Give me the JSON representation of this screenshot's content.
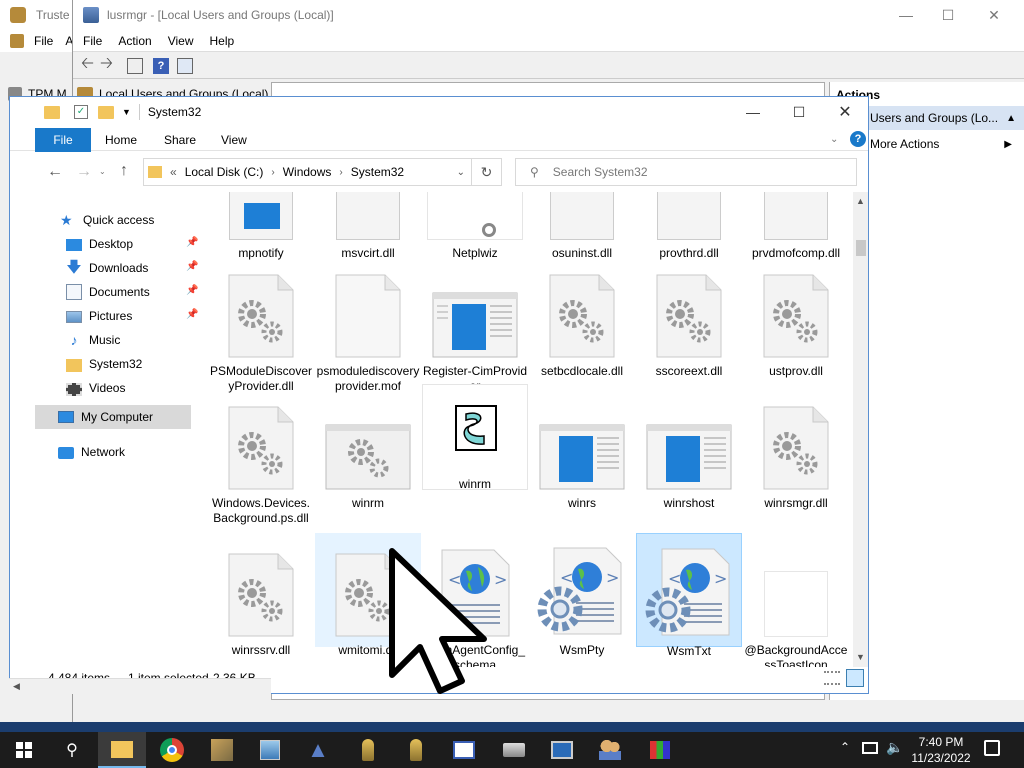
{
  "background_window": {
    "title": "Truste",
    "menu": {
      "file": "File",
      "a": "A"
    },
    "tree_item": "TPM M"
  },
  "lusrmgr": {
    "title": "lusrmgr - [Local Users and Groups (Local)]",
    "menu": [
      "File",
      "Action",
      "View",
      "Help"
    ],
    "tree_item": "Local Users and Groups (Local)",
    "actions_header": "Actions",
    "actions_item": "Users and Groups (Lo...",
    "more_actions": "More Actions"
  },
  "explorer": {
    "title": "System32",
    "ribbon_tabs": [
      "File",
      "Home",
      "Share",
      "View"
    ],
    "address": {
      "prefix": "«",
      "parts": [
        "Local Disk (C:)",
        "Windows",
        "System32"
      ]
    },
    "search_placeholder": "Search System32",
    "nav": {
      "quick_access": "Quick access",
      "items": [
        "Desktop",
        "Downloads",
        "Documents",
        "Pictures",
        "Music",
        "System32",
        "Videos"
      ],
      "my_computer": "My Computer",
      "network": "Network"
    },
    "files_row0": [
      "mpnotify",
      "msvcirt.dll",
      "Netplwiz",
      "osuninst.dll",
      "provthrd.dll",
      "prvdmofcomp.dll"
    ],
    "files_row1": [
      "PSModuleDiscoveryProvider.dll",
      "psmodulediscoveryprovider.mof",
      "Register-CimProvider",
      "setbcdlocale.dll",
      "sscoreext.dll",
      "ustprov.dll"
    ],
    "files_row2": [
      "Windows.Devices.Background.ps.dll",
      "winrm",
      "winrm",
      "winrs",
      "winrshost",
      "winrsmgr.dll"
    ],
    "files_row3": [
      "winrssrv.dll",
      "wmitomi.dll",
      "WsmAgentConfig_schema",
      "WsmPty",
      "WsmTxt",
      "@BackgroundAccessToastIcon"
    ],
    "status": {
      "items": "4,484 items",
      "selected": "1 item selected",
      "size": "2.36 KB"
    }
  },
  "taskbar": {
    "time": "7:40 PM",
    "date": "11/23/2022"
  },
  "colors": {
    "accent": "#1979ca",
    "selection": "#cce8ff",
    "taskbar": "#1c1c1c"
  }
}
